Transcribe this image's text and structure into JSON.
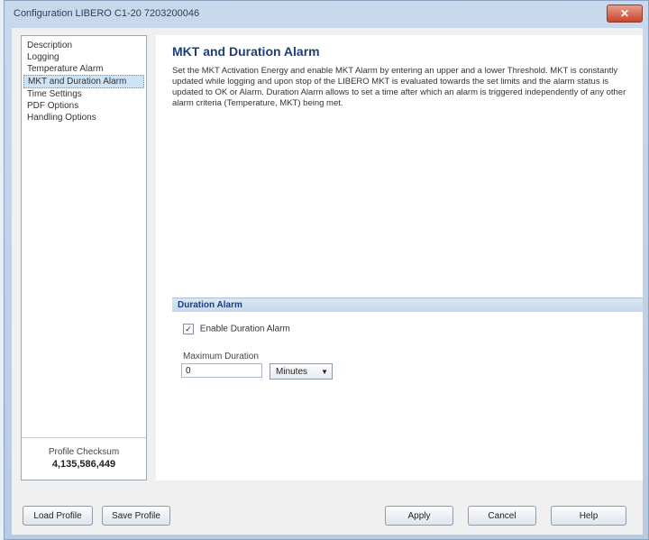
{
  "window": {
    "title": "Configuration LIBERO C1-20 7203200046",
    "close_glyph": "✕"
  },
  "nav": {
    "items": [
      {
        "label": "Description"
      },
      {
        "label": "Logging"
      },
      {
        "label": "Temperature Alarm"
      },
      {
        "label": "MKT and Duration Alarm"
      },
      {
        "label": "Time Settings"
      },
      {
        "label": "PDF Options"
      },
      {
        "label": "Handling Options"
      }
    ],
    "selected_index": 3,
    "checksum_label": "Profile Checksum",
    "checksum_value": "4,135,586,449"
  },
  "main": {
    "title": "MKT and Duration Alarm",
    "description": "Set the MKT Activation Energy and enable MKT Alarm by entering an upper and a lower Threshold. MKT is constantly updated while logging and upon stop of the LIBERO MKT is evaluated towards the set limits and the alarm status is updated to OK or Alarm. Duration Alarm allows to set a time after which an alarm is triggered independently of any other alarm criteria (Temperature, MKT) being met.",
    "section_title": "Duration Alarm",
    "enable_label": "Enable Duration Alarm",
    "enable_checked": true,
    "checkmark": "✓",
    "max_duration_label": "Maximum Duration",
    "max_duration_value": "0",
    "unit_value": "Minutes",
    "unit_arrow": "▼"
  },
  "footer": {
    "load_profile": "Load Profile",
    "save_profile": "Save Profile",
    "apply": "Apply",
    "cancel": "Cancel",
    "help": "Help"
  }
}
